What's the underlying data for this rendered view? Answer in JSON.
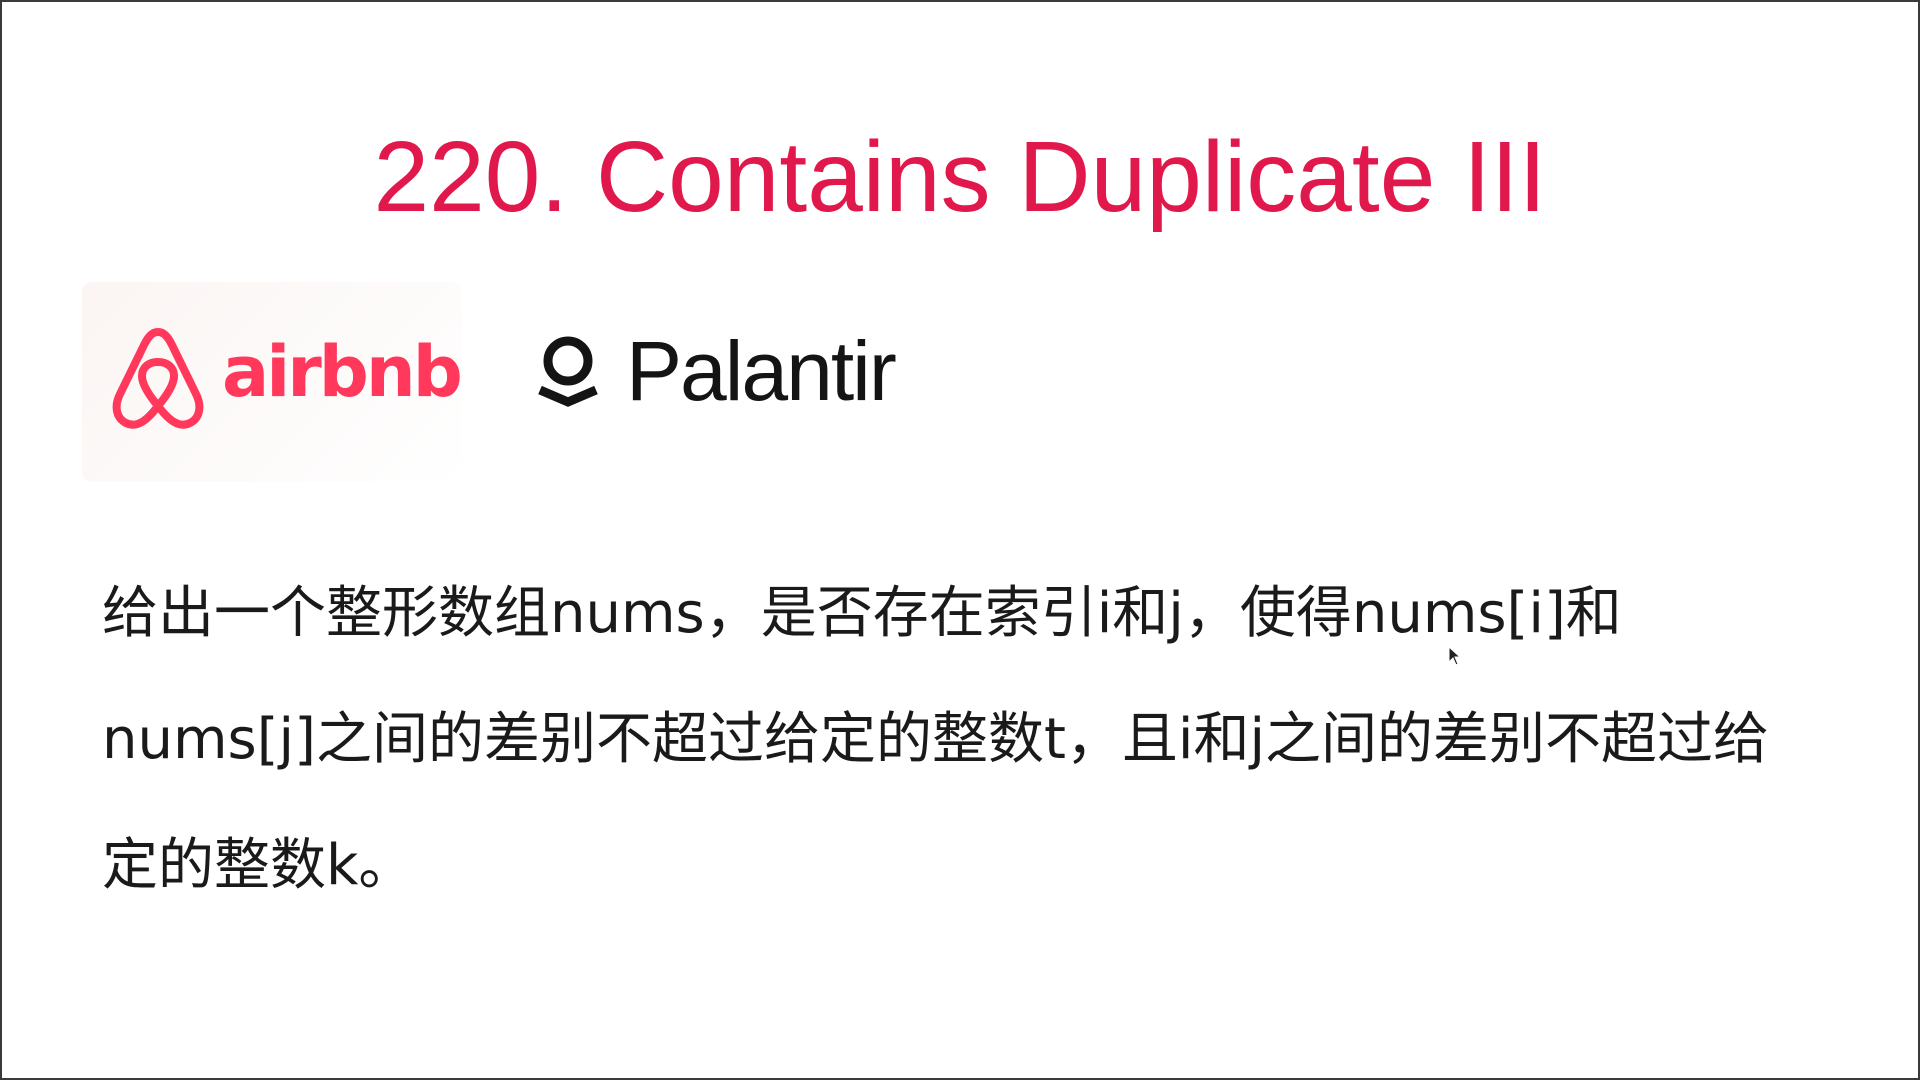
{
  "slide": {
    "title": "220. Contains Duplicate III",
    "title_color": "#e0184b",
    "logos": [
      {
        "name": "airbnb",
        "wordmark": "airbnb",
        "icon": "airbnb-belo-icon",
        "color": "#ff385c"
      },
      {
        "name": "Palantir",
        "wordmark": "Palantir",
        "icon": "palantir-icon",
        "color": "#141414"
      }
    ],
    "description_lines": [
      "给出一个整形数组nums，是否存在索引i和j，使得nums[i]和",
      "nums[j]之间的差别不超过给定的整数t，且i和j之间的差别不超过给",
      "定的整数k。"
    ]
  }
}
